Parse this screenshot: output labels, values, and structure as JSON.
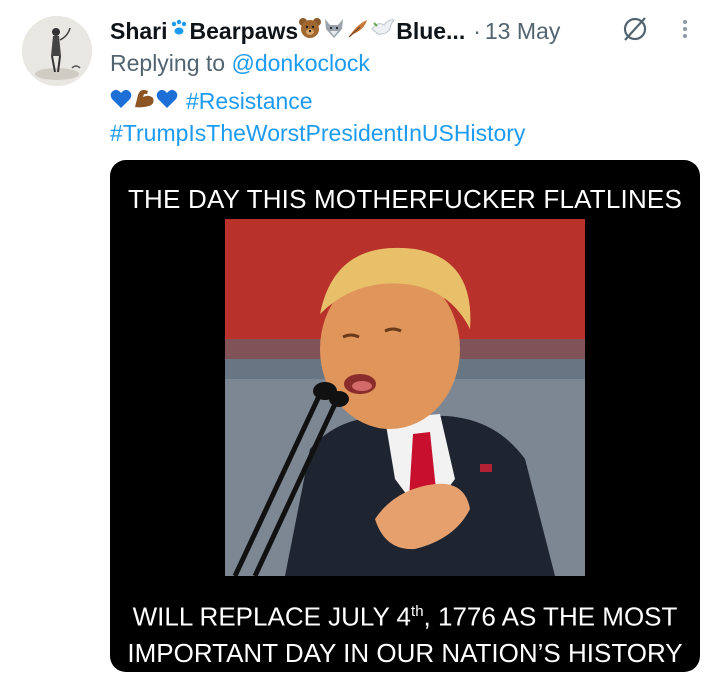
{
  "tweet": {
    "author_name": "Shari",
    "author_name_2": "Bearpaws",
    "author_name_3": "Blue...",
    "separator": "·",
    "date": "13 May",
    "replying_prefix": "Replying to",
    "replying_handle": "@donkoclock",
    "hashtag_1": "#Resistance",
    "hashtag_2": "#TrumpIsTheWorstPresidentInUSHistory"
  },
  "media": {
    "top_caption": "THE DAY THIS MOTHERFUCKER FLATLINES",
    "bottom_caption_line1_a": "WILL REPLACE JULY 4",
    "bottom_caption_line1_sup": "th",
    "bottom_caption_line1_b": ", 1776 AS THE MOST",
    "bottom_caption_line2": "IMPORTANT DAY IN OUR NATION’S HISTORY"
  },
  "icons": {
    "name_emoji": [
      "paw-prints-icon",
      "bear-face-icon",
      "wolf-face-icon",
      "feather-icon",
      "dove-icon"
    ],
    "text_emoji": [
      "blue-heart-icon",
      "flexed-biceps-icon",
      "blue-heart-icon"
    ],
    "header_icons": [
      "grok-icon",
      "more-icon"
    ]
  },
  "colors": {
    "link": "#1d9bf0",
    "secondary": "#536471",
    "text": "#0f1419"
  }
}
